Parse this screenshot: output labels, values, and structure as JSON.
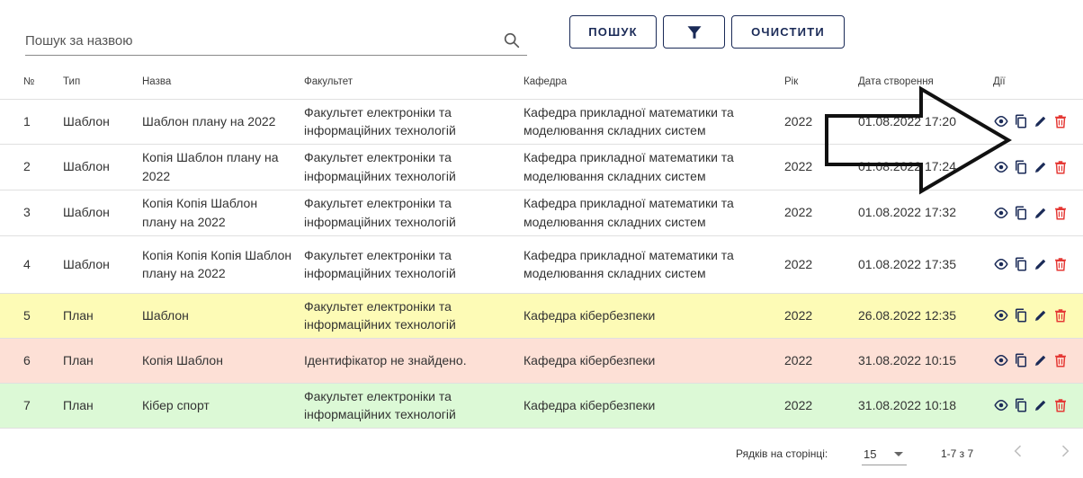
{
  "toolbar": {
    "search_placeholder": "Пошук за назвою",
    "search_value": "",
    "search_button": "ПОШУК",
    "filter_icon": "filter-icon",
    "clear_button": "ОЧИСТИТИ"
  },
  "table": {
    "headers": [
      "№",
      "Тип",
      "Назва",
      "Факультет",
      "Кафедра",
      "Рік",
      "Дата створення",
      "Дії"
    ],
    "rows": [
      {
        "num": "1",
        "type": "Шаблон",
        "name": "Шаблон плану на 2022",
        "faculty": "Факультет електроніки та інформаційних технологій",
        "department": "Кафедра прикладної математики та моделювання складних систем",
        "year": "2022",
        "created": "01.08.2022 17:20",
        "highlight": "none"
      },
      {
        "num": "2",
        "type": "Шаблон",
        "name": "Копія Шаблон плану на 2022",
        "faculty": "Факультет електроніки та інформаційних технологій",
        "department": "Кафедра прикладної математики та моделювання складних систем",
        "year": "2022",
        "created": "01.08.2022 17:24",
        "highlight": "none"
      },
      {
        "num": "3",
        "type": "Шаблон",
        "name": "Копія Копія Шаблон плану на 2022",
        "faculty": "Факультет електроніки та інформаційних технологій",
        "department": "Кафедра прикладної математики та моделювання складних систем",
        "year": "2022",
        "created": "01.08.2022 17:32",
        "highlight": "none"
      },
      {
        "num": "4",
        "type": "Шаблон",
        "name": "Копія Копія Копія Шаблон плану на 2022",
        "faculty": "Факультет електроніки та інформаційних технологій",
        "department": "Кафедра прикладної математики та моделювання складних систем",
        "year": "2022",
        "created": "01.08.2022 17:35",
        "highlight": "none"
      },
      {
        "num": "5",
        "type": "План",
        "name": "Шаблон",
        "faculty": "Факультет електроніки та інформаційних технологій",
        "department": "Кафедра кібербезпеки",
        "year": "2022",
        "created": "26.08.2022 12:35",
        "highlight": "yellow"
      },
      {
        "num": "6",
        "type": "План",
        "name": "Копія Шаблон",
        "faculty": "Ідентифікатор не знайдено.",
        "department": "Кафедра кібербезпеки",
        "year": "2022",
        "created": "31.08.2022 10:15",
        "highlight": "red"
      },
      {
        "num": "7",
        "type": "План",
        "name": "Кібер спорт",
        "faculty": "Факультет електроніки та інформаційних технологій",
        "department": "Кафедра кібербезпеки",
        "year": "2022",
        "created": "31.08.2022 10:18",
        "highlight": "green"
      }
    ],
    "row_actions": [
      "view-icon",
      "copy-icon",
      "edit-icon",
      "delete-icon"
    ]
  },
  "footer": {
    "rows_per_page_label": "Рядків на сторінці:",
    "rows_per_page_value": "15",
    "range_text": "1-7 з 7",
    "prev_icon": "chevron-left-icon",
    "next_icon": "chevron-right-icon"
  },
  "colors": {
    "primary": "#1a2a57",
    "row_yellow": "#fdfbb6",
    "row_red": "#fde0d6",
    "row_green": "#dcf9d6",
    "delete_red": "#e53935"
  }
}
